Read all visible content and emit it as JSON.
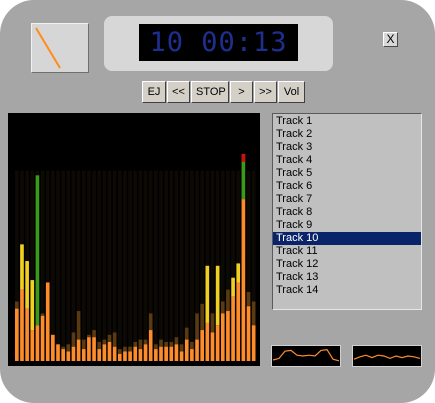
{
  "display": {
    "time": "10 00:13"
  },
  "window": {
    "close_label": "X"
  },
  "controls": [
    {
      "id": "eject",
      "label": "EJ"
    },
    {
      "id": "rewind",
      "label": "<<"
    },
    {
      "id": "stop",
      "label": "STOP"
    },
    {
      "id": "next",
      "label": ">"
    },
    {
      "id": "fast-forward",
      "label": ">>"
    },
    {
      "id": "volume",
      "label": "Vol"
    }
  ],
  "playlist": {
    "selected_index": 9,
    "tracks": [
      "Track 1",
      "Track 2",
      "Track 3",
      "Track 4",
      "Track 5",
      "Track 6",
      "Track 7",
      "Track 8",
      "Track 9",
      "Track 10",
      "Track 11",
      "Track 12",
      "Track 13",
      "Track 14"
    ]
  },
  "spectrum": {
    "levels": [
      0.22,
      0.3,
      0.22,
      0.13,
      0.15,
      0.19,
      0.33,
      0.11,
      0.07,
      0.05,
      0.04,
      0.06,
      0.09,
      0.05,
      0.1,
      0.1,
      0.05,
      0.07,
      0.08,
      0.06,
      0.03,
      0.04,
      0.04,
      0.06,
      0.05,
      0.07,
      0.13,
      0.05,
      0.06,
      0.06,
      0.06,
      0.07,
      0.04,
      0.09,
      0.05,
      0.09,
      0.13,
      0.16,
      0.12,
      0.15,
      0.2,
      0.21,
      0.27,
      0.33,
      0.68,
      0.23,
      0.15
    ],
    "peaks": [
      0.25,
      0.49,
      0.42,
      0.34,
      0.78,
      0.2,
      0.16,
      0.11,
      0.07,
      0.06,
      0.07,
      0.12,
      0.21,
      0.09,
      0.11,
      0.13,
      0.08,
      0.09,
      0.11,
      0.12,
      0.05,
      0.06,
      0.06,
      0.08,
      0.09,
      0.09,
      0.2,
      0.07,
      0.09,
      0.08,
      0.08,
      0.1,
      0.07,
      0.14,
      0.08,
      0.2,
      0.24,
      0.4,
      0.2,
      0.4,
      0.25,
      0.3,
      0.35,
      0.41,
      0.87,
      0.29,
      0.25
    ],
    "colors": {
      "low": "#ff8c2a",
      "mid": "#f0d020",
      "high": "#3c9a1a",
      "top": "#cc1010"
    }
  },
  "waveforms": {
    "color": "#ff8c2a",
    "left": [
      0.25,
      0.35,
      0.8,
      0.85,
      0.55,
      0.5,
      0.55,
      0.5,
      0.85,
      0.9,
      0.3,
      0.2
    ],
    "right": [
      0.3,
      0.45,
      0.55,
      0.4,
      0.55,
      0.5,
      0.35,
      0.5,
      0.4,
      0.5,
      0.45,
      0.35
    ]
  }
}
